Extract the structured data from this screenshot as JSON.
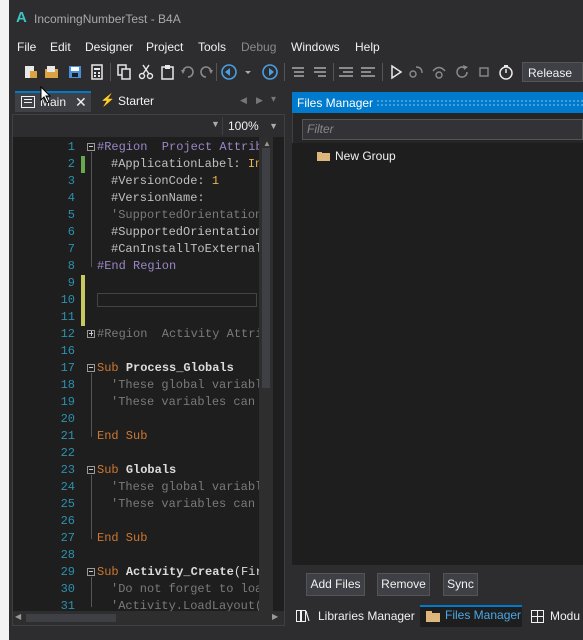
{
  "window": {
    "title": "IncomingNumberTest - B4A",
    "logo": "A"
  },
  "menu": [
    "File",
    "Edit",
    "Designer",
    "Project",
    "Tools",
    "Debug",
    "Windows",
    "Help"
  ],
  "menu_disabled": [
    "Debug"
  ],
  "toolbar": {
    "icons": [
      "new-icon",
      "open-icon",
      "save-icon",
      "calculator-icon",
      "copy-icon",
      "cut-icon",
      "paste-icon",
      "undo-icon",
      "redo-icon",
      "back-icon",
      "dropdown-icon",
      "forward-icon",
      "comment-icon",
      "uncomment-icon",
      "indent-icon",
      "outdent-icon",
      "run-icon",
      "step-icon",
      "step-over-icon",
      "restart-icon",
      "stop-icon",
      "timer-icon"
    ],
    "build_config": "Release"
  },
  "editor": {
    "tabs": [
      {
        "label": "Main",
        "active": true
      },
      {
        "label": "Starter",
        "active": false
      }
    ],
    "zoom": "100%",
    "lines": [
      {
        "n": "1",
        "fold": "minus",
        "tokens": [
          {
            "t": "#Region  Project Attrib",
            "c": "rg"
          }
        ]
      },
      {
        "n": "2",
        "indent": 1,
        "tokens": [
          {
            "t": "#ApplicationLabel: ",
            "c": "dir"
          },
          {
            "t": "In",
            "c": "hl"
          }
        ]
      },
      {
        "n": "3",
        "indent": 1,
        "tokens": [
          {
            "t": "#VersionCode: ",
            "c": "dir"
          },
          {
            "t": "1",
            "c": "hl"
          }
        ]
      },
      {
        "n": "4",
        "indent": 1,
        "tokens": [
          {
            "t": "#VersionName:",
            "c": "dir"
          }
        ]
      },
      {
        "n": "5",
        "indent": 1,
        "tokens": [
          {
            "t": "'SupportedOrientation",
            "c": "cm"
          }
        ]
      },
      {
        "n": "6",
        "indent": 1,
        "tokens": [
          {
            "t": "#SupportedOrientation",
            "c": "dir"
          }
        ]
      },
      {
        "n": "7",
        "indent": 1,
        "tokens": [
          {
            "t": "#CanInstallToExternal",
            "c": "dir"
          }
        ]
      },
      {
        "n": "8",
        "tokens": [
          {
            "t": "#End Region",
            "c": "rg"
          }
        ]
      },
      {
        "n": "9",
        "tokens": []
      },
      {
        "n": "10",
        "tokens": []
      },
      {
        "n": "11",
        "tokens": []
      },
      {
        "n": "12",
        "fold": "plus",
        "tokens": [
          {
            "t": "#Region  Activity Attri",
            "c": "cm"
          }
        ]
      },
      {
        "n": "16",
        "tokens": []
      },
      {
        "n": "17",
        "fold": "minus",
        "tokens": [
          {
            "t": "Sub ",
            "c": "kw"
          },
          {
            "t": "Process_Globals",
            "c": "id",
            "b": true
          }
        ]
      },
      {
        "n": "18",
        "indent": 1,
        "tokens": [
          {
            "t": "'These global variabl",
            "c": "cm"
          }
        ]
      },
      {
        "n": "19",
        "indent": 1,
        "tokens": [
          {
            "t": "'These variables can",
            "c": "cm"
          }
        ]
      },
      {
        "n": "20",
        "tokens": []
      },
      {
        "n": "21",
        "tokens": [
          {
            "t": "End Sub",
            "c": "kw"
          }
        ]
      },
      {
        "n": "22",
        "tokens": []
      },
      {
        "n": "23",
        "fold": "minus",
        "tokens": [
          {
            "t": "Sub ",
            "c": "kw"
          },
          {
            "t": "Globals",
            "c": "id",
            "b": true
          }
        ]
      },
      {
        "n": "24",
        "indent": 1,
        "tokens": [
          {
            "t": "'These global variabl",
            "c": "cm"
          }
        ]
      },
      {
        "n": "25",
        "indent": 1,
        "tokens": [
          {
            "t": "'These variables can",
            "c": "cm"
          }
        ]
      },
      {
        "n": "26",
        "tokens": []
      },
      {
        "n": "27",
        "tokens": [
          {
            "t": "End Sub",
            "c": "kw"
          }
        ]
      },
      {
        "n": "28",
        "tokens": []
      },
      {
        "n": "29",
        "fold": "minus",
        "tokens": [
          {
            "t": "Sub ",
            "c": "kw"
          },
          {
            "t": "Activity_Create",
            "c": "id",
            "b": true
          },
          {
            "t": "(Fir",
            "c": "id"
          }
        ]
      },
      {
        "n": "30",
        "indent": 1,
        "tokens": [
          {
            "t": "'Do not forget to loa",
            "c": "cm"
          }
        ]
      },
      {
        "n": "31",
        "indent": 1,
        "tokens": [
          {
            "t": "'Activity.LoadLayout(",
            "c": "cm"
          }
        ]
      }
    ]
  },
  "files_manager": {
    "title": "Files Manager",
    "filter_placeholder": "Filter",
    "items": [
      {
        "label": "New Group",
        "icon": "folder-icon"
      }
    ],
    "buttons": {
      "add": "Add Files",
      "remove": "Remove",
      "sync": "Sync"
    }
  },
  "bottom_tabs": [
    {
      "label": "Libraries Manager",
      "icon": "books-icon"
    },
    {
      "label": "Files Manager",
      "icon": "folder-icon",
      "active": true
    },
    {
      "label": "Modu",
      "icon": "grid-icon"
    }
  ],
  "colors": {
    "accent": "#007acc",
    "background": "#2d2d30",
    "editor_bg": "#1e1e1e",
    "keyword": "#cc7832",
    "comment": "#7a7a7a",
    "region": "#9a86c5",
    "line_number": "#2b91af"
  }
}
